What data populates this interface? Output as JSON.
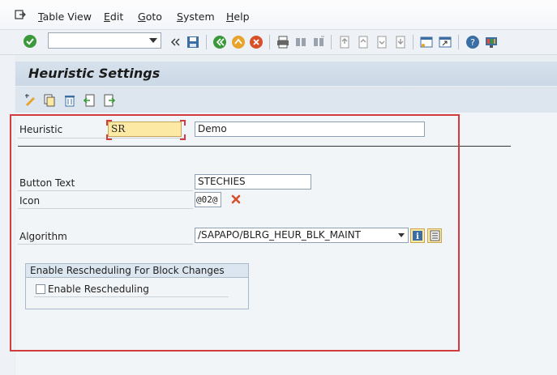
{
  "menu": {
    "items": [
      {
        "first": "T",
        "rest": "able View"
      },
      {
        "first": "E",
        "rest": "dit"
      },
      {
        "first": "G",
        "rest": "oto"
      },
      {
        "first": "S",
        "rest": "ystem"
      },
      {
        "first": "H",
        "rest": "elp"
      }
    ]
  },
  "toolbar": {
    "command_value": "",
    "icons": [
      "enter-checkmark-icon",
      "save-icon",
      "back-icon",
      "exit-icon",
      "cancel-icon",
      "print-icon",
      "find-icon",
      "find-next-icon",
      "first-page-icon",
      "previous-page-icon",
      "next-page-icon",
      "last-page-icon",
      "create-session-icon",
      "shortcut-icon",
      "help-icon",
      "customize-layout-icon"
    ],
    "colors": {
      "ok": "#3a9a3a",
      "nav": "#e8a42a",
      "cancel": "#d8502a"
    }
  },
  "screen": {
    "title": "Heuristic Settings",
    "app_icons": [
      "display-change-icon",
      "copy-icon",
      "delete-icon",
      "undo-icon",
      "select-icon"
    ]
  },
  "form": {
    "heuristic_label": "Heuristic",
    "heuristic_value": "SR",
    "heuristic_desc": "Demo",
    "button_text_label": "Button Text",
    "button_text_value": "STECHIES",
    "icon_label": "Icon",
    "icon_value": "@02@",
    "algorithm_label": "Algorithm",
    "algorithm_value": "/SAPAPO/BLRG_HEUR_BLK_MAINT",
    "group_title": "Enable Rescheduling For Block Changes",
    "checkbox_label": "Enable Rescheduling",
    "checkbox_checked": false
  },
  "annotation": {
    "highlight_color": "#d23c3c"
  }
}
